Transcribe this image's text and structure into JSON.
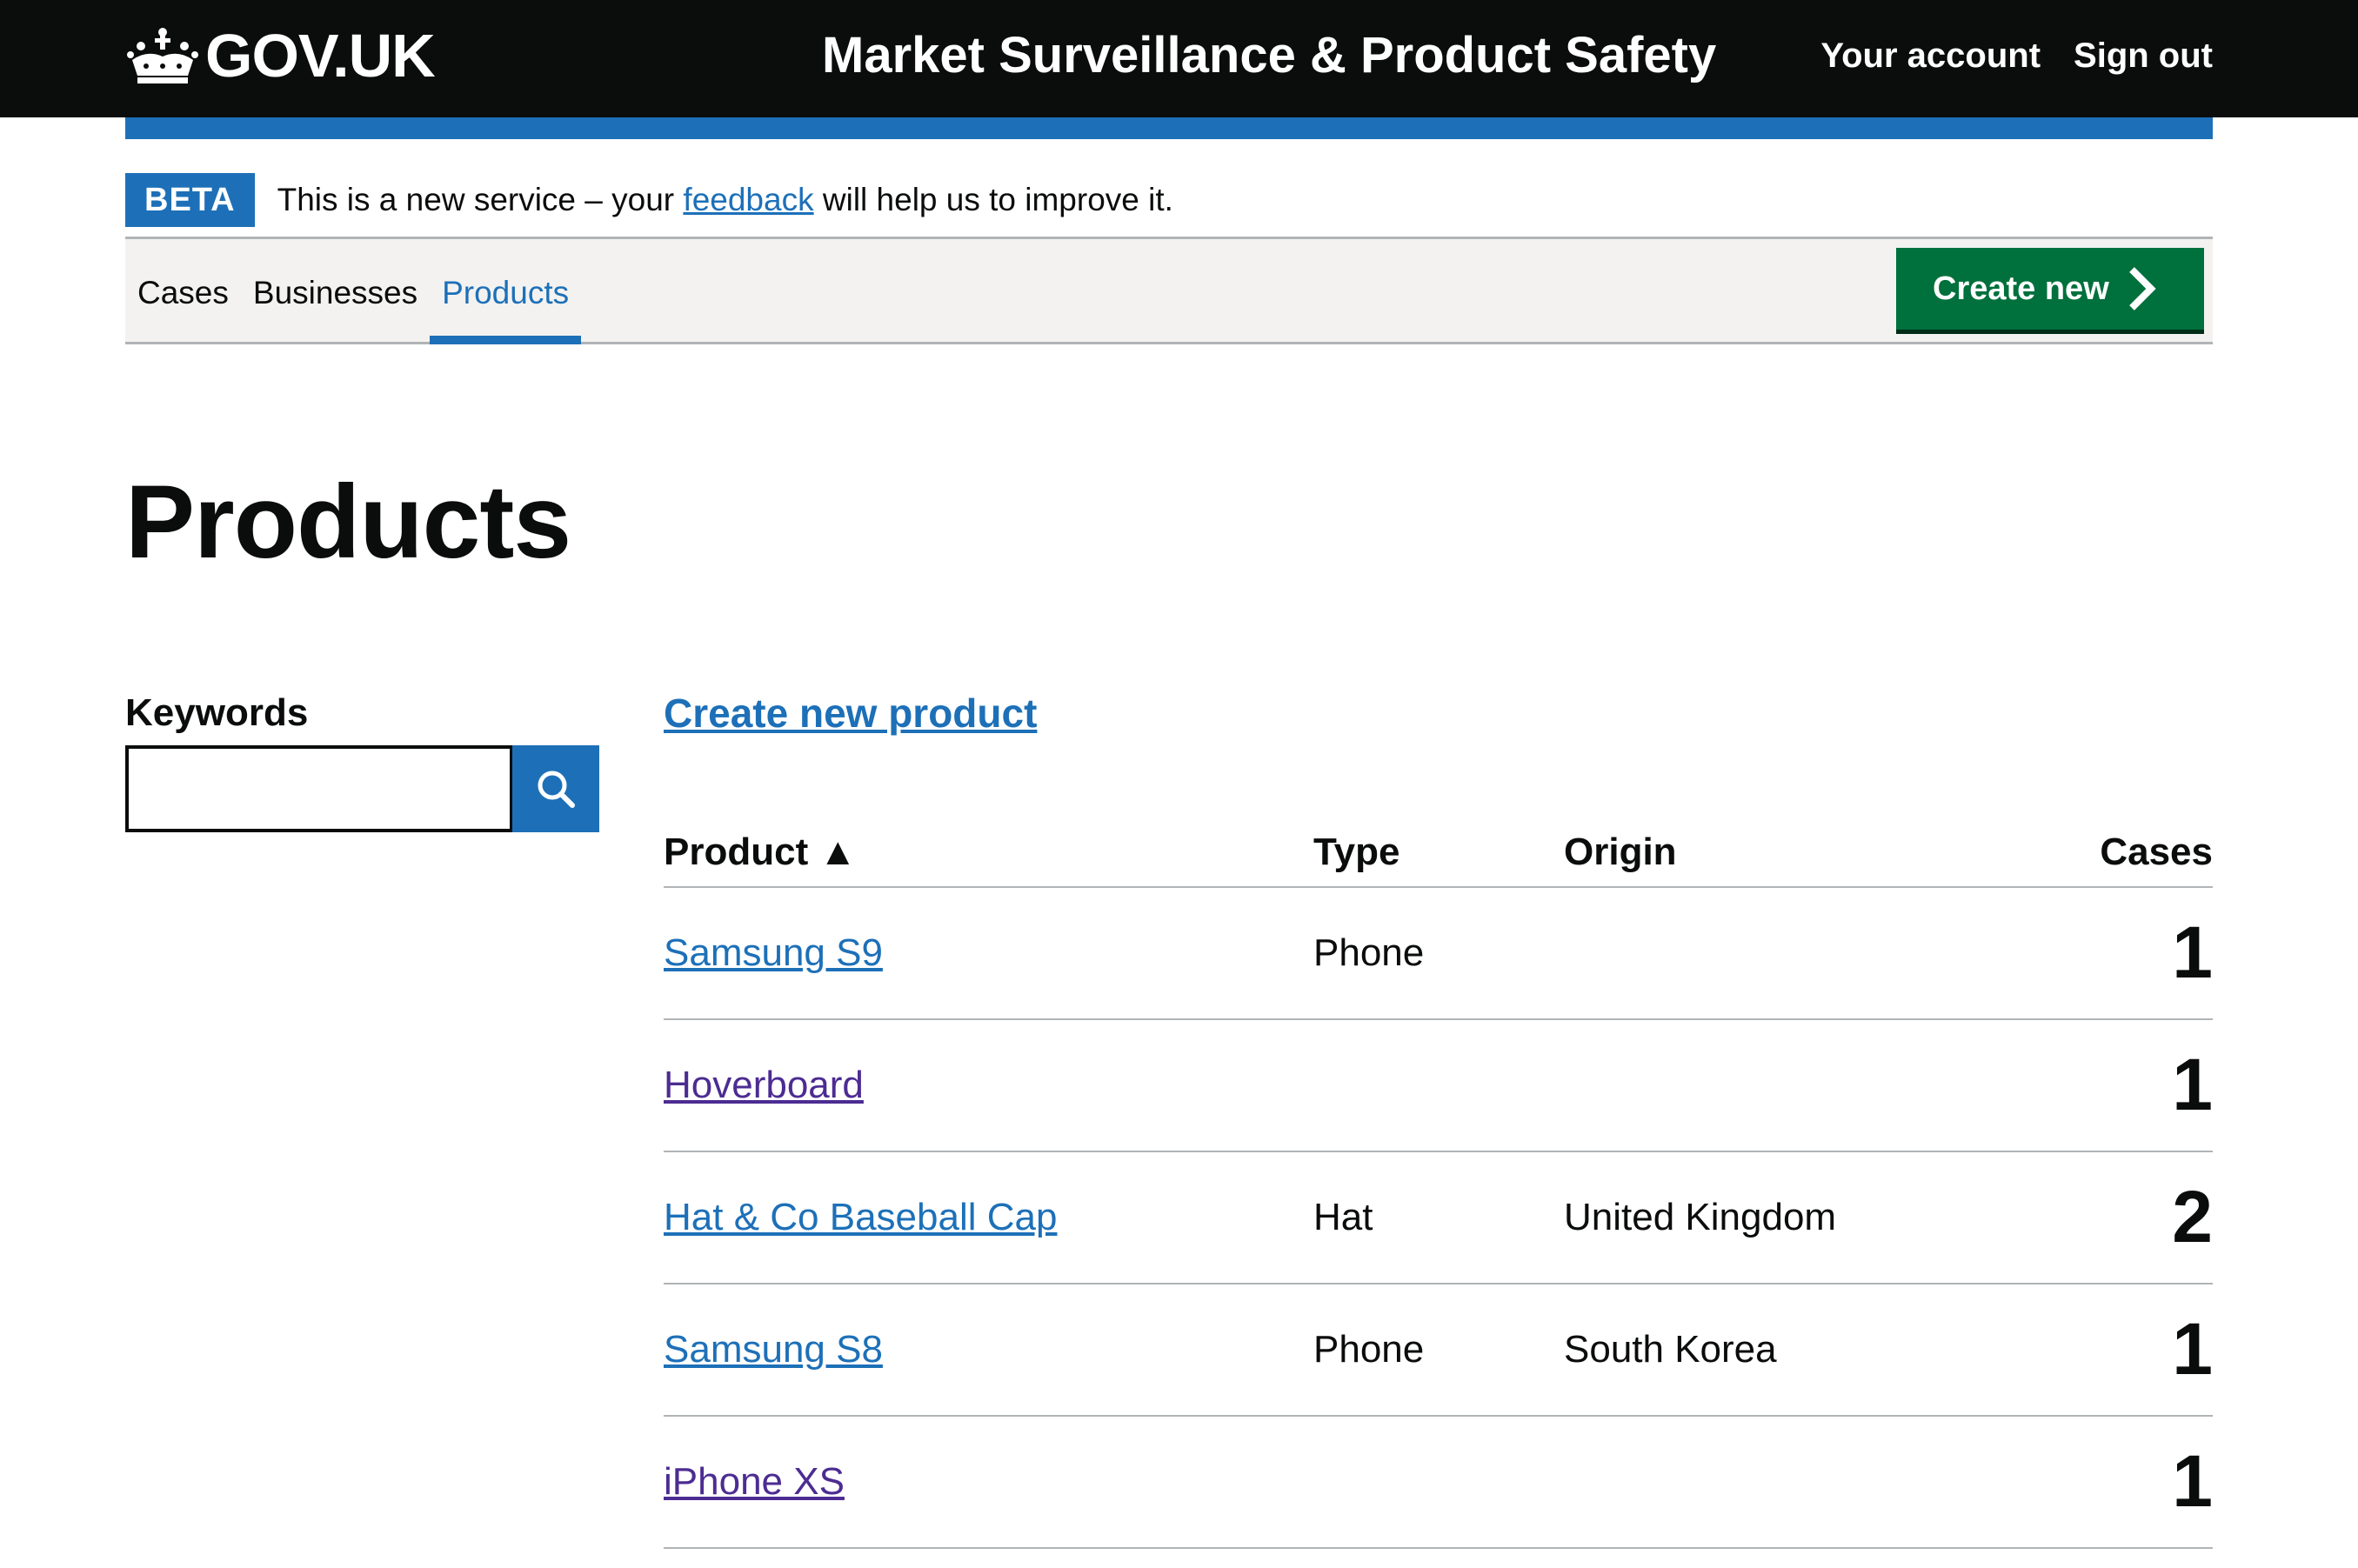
{
  "header": {
    "logo_text": "GOV.UK",
    "service_name": "Market Surveillance & Product Safety",
    "links": [
      "Your account",
      "Sign out"
    ]
  },
  "phase": {
    "tag": "BETA",
    "text_before": "This is a new service – your ",
    "link": "feedback",
    "text_after": " will help us to improve it."
  },
  "subnav": {
    "items": [
      "Cases",
      "Businesses",
      "Products"
    ],
    "active": "Products",
    "create_button": "Create new"
  },
  "page": {
    "title": "Products",
    "keywords_label": "Keywords",
    "keywords_value": "",
    "create_link": "Create new product"
  },
  "table": {
    "headers": {
      "product": "Product ▲",
      "type": "Type",
      "origin": "Origin",
      "cases": "Cases"
    },
    "rows": [
      {
        "product": "Samsung S9",
        "type": "Phone",
        "origin": "",
        "cases": "1"
      },
      {
        "product": "Hoverboard",
        "type": "",
        "origin": "",
        "cases": "1"
      },
      {
        "product": "Hat & Co Baseball Cap",
        "type": "Hat",
        "origin": "United Kingdom",
        "cases": "2"
      },
      {
        "product": "Samsung S8",
        "type": "Phone",
        "origin": "South Korea",
        "cases": "1"
      },
      {
        "product": "iPhone XS",
        "type": "",
        "origin": "",
        "cases": "1"
      }
    ]
  },
  "colors": {
    "header_bg": "#0b0c0c",
    "brand_blue": "#1d70b8",
    "button_green": "#00703c",
    "visited_link": "#4c2c92"
  }
}
